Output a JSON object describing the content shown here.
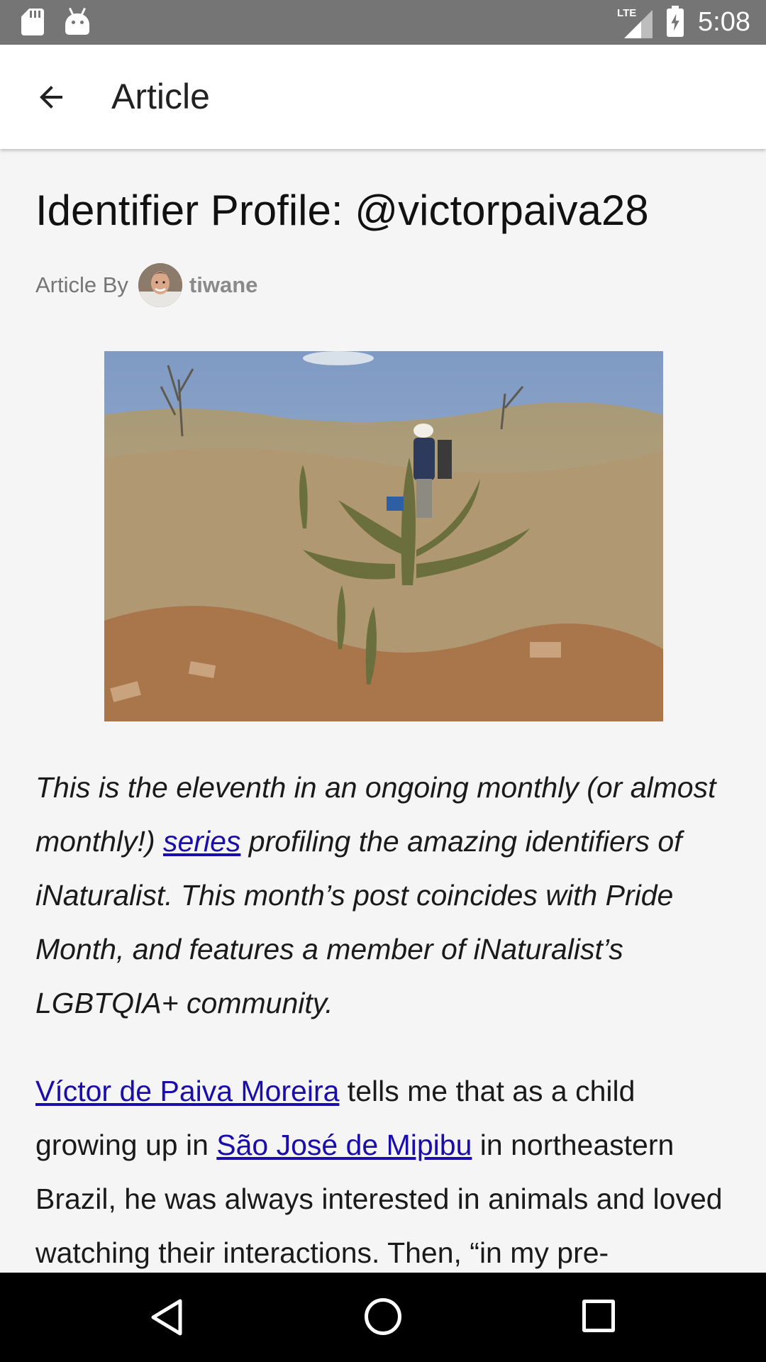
{
  "status_bar": {
    "network": "LTE",
    "time": "5:08",
    "icons": [
      "sd-card-icon",
      "android-icon",
      "signal-icon",
      "battery-charging-icon"
    ]
  },
  "app_bar": {
    "title": "Article",
    "back_icon": "arrow-left-icon"
  },
  "article": {
    "title": "Identifier Profile: @victorpaiva28",
    "byline_label": "Article By",
    "author": "tiwane",
    "image_alt": "Person walking through dry scrubland with cacti",
    "intro": {
      "before_link": "This is the eleventh in an ongoing monthly (or almost monthly!) ",
      "link": "series",
      "after_link": " profiling the amazing identifiers of iNaturalist. This month’s post coincides with Pride Month, and features a member of iNaturalist’s LGBTQIA+ community."
    },
    "body": {
      "link1": "Víctor de Paiva Moreira",
      "text1": " tells me that as a child growing up in ",
      "link2": "São José de Mipibu",
      "text2": " in northeastern Brazil, he was always interested in animals and loved watching their interactions. Then, “in my pre-"
    }
  },
  "nav_bar": {
    "icons": [
      "nav-back-icon",
      "nav-home-icon",
      "nav-recents-icon"
    ]
  }
}
